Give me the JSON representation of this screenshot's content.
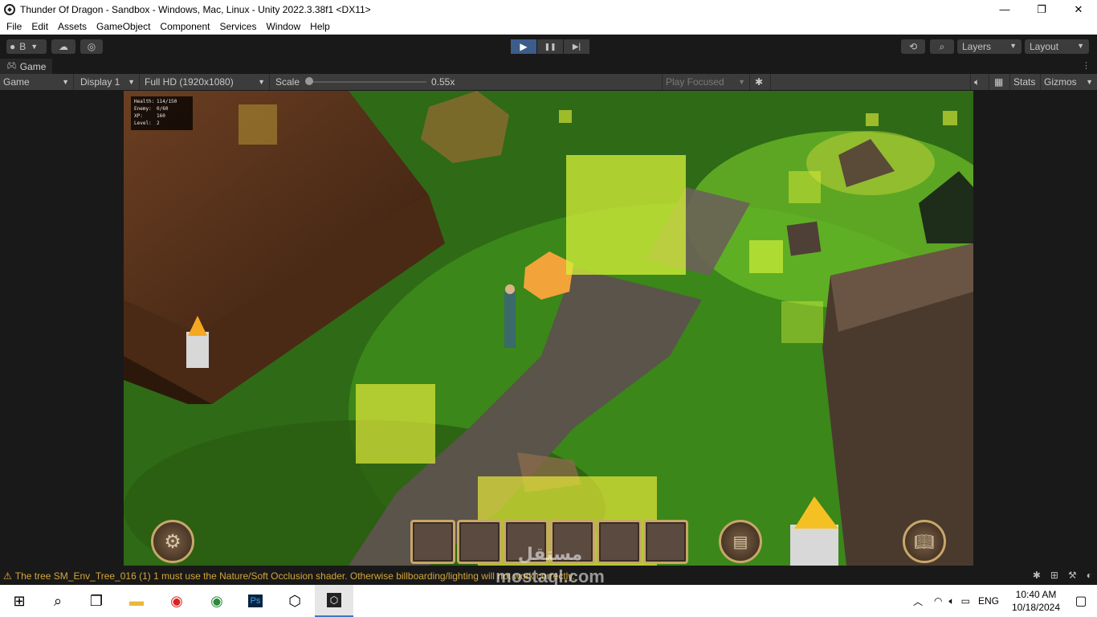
{
  "window": {
    "title": "Thunder Of Dragon - Sandbox - Windows, Mac, Linux - Unity 2022.3.38f1 <DX11>",
    "controls": {
      "minimize": "—",
      "maximize": "❐",
      "close": "✕"
    }
  },
  "menu": [
    "File",
    "Edit",
    "Assets",
    "GameObject",
    "Component",
    "Services",
    "Window",
    "Help"
  ],
  "toolbar": {
    "account_label": "B",
    "layers_label": "Layers",
    "layout_label": "Layout",
    "play_icon": "▶",
    "pause_icon": "❚❚",
    "step_icon": "▶|"
  },
  "tab": {
    "label": "Game"
  },
  "game_bar": {
    "mode": "Game",
    "display": "Display 1",
    "resolution": "Full HD (1920x1080)",
    "scale_label": "Scale",
    "scale_value": "0.55x",
    "play_focused": "Play Focused",
    "stats": "Stats",
    "gizmos": "Gizmos"
  },
  "hud": {
    "rows": [
      {
        "key": "Health:",
        "value": "114/150"
      },
      {
        "key": "Enemy:",
        "value": "0/60"
      },
      {
        "key": "XP:",
        "value": "160"
      },
      {
        "key": "Level:",
        "value": "2"
      }
    ]
  },
  "console": {
    "message": "The tree SM_Env_Tree_016 (1) 1 must use the Nature/Soft Occlusion shader. Otherwise billboarding/lighting will not work correctly."
  },
  "taskbar": {
    "language": "ENG",
    "time": "10:40 AM",
    "date": "10/18/2024"
  },
  "watermark": {
    "arabic": "مستقل",
    "latin": "mostaql.com"
  },
  "colors": {
    "play_active": "#3c5d8a",
    "warning": "#f0b43c",
    "slot_border": "#c7a76a"
  }
}
